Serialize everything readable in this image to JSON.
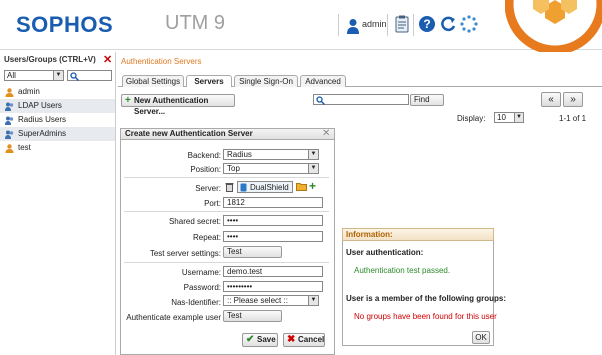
{
  "header": {
    "logo": "SOPHOS",
    "product": "UTM 9",
    "username": "admin"
  },
  "left": {
    "title": "Users/Groups (CTRL+V)",
    "filter_value": "All",
    "items": [
      {
        "label": "admin",
        "icon": "user-icon"
      },
      {
        "label": "LDAP Users",
        "icon": "group-icon"
      },
      {
        "label": "Radius Users",
        "icon": "group-icon"
      },
      {
        "label": "SuperAdmins",
        "icon": "group-icon"
      },
      {
        "label": "test",
        "icon": "user-icon"
      }
    ]
  },
  "main": {
    "breadcrumb": "Authentication Servers",
    "tabs": [
      "Global Settings",
      "Servers",
      "Single Sign-On",
      "Advanced"
    ],
    "active_tab": "Servers",
    "new_button": "New Authentication Server...",
    "find_button": "Find",
    "display_label": "Display:",
    "display_value": "10",
    "page_count": "1-1 of 1"
  },
  "dialog": {
    "title": "Create new Authentication Server",
    "backend_label": "Backend:",
    "backend_value": "Radius",
    "position_label": "Position:",
    "position_value": "Top",
    "server_label": "Server:",
    "server_value": "DualShield",
    "port_label": "Port:",
    "port_value": "1812",
    "secret_label": "Shared secret:",
    "secret_value": "••••",
    "repeat_label": "Repeat:",
    "repeat_value": "••••",
    "test_settings_label": "Test server settings:",
    "test_button": "Test",
    "username_label": "Username:",
    "username_value": "demo.test",
    "password_label": "Password:",
    "password_value": "•••••••••",
    "nas_label": "Nas-Identifier:",
    "nas_value": ":: Please select ::",
    "auth_example_label": "Authenticate example user",
    "auth_test_button": "Test",
    "save_button": "Save",
    "cancel_button": "Cancel"
  },
  "info": {
    "title": "Information:",
    "auth_heading": "User authentication:",
    "auth_result": "Authentication test passed.",
    "groups_heading": "User is a member of the following groups:",
    "groups_result": "No groups have been found for this user",
    "ok_button": "OK"
  },
  "colors": {
    "brand_blue": "#1a5db0",
    "accent_orange": "#e07820",
    "success_green": "#2a8a2a",
    "error_red": "#d00000"
  }
}
